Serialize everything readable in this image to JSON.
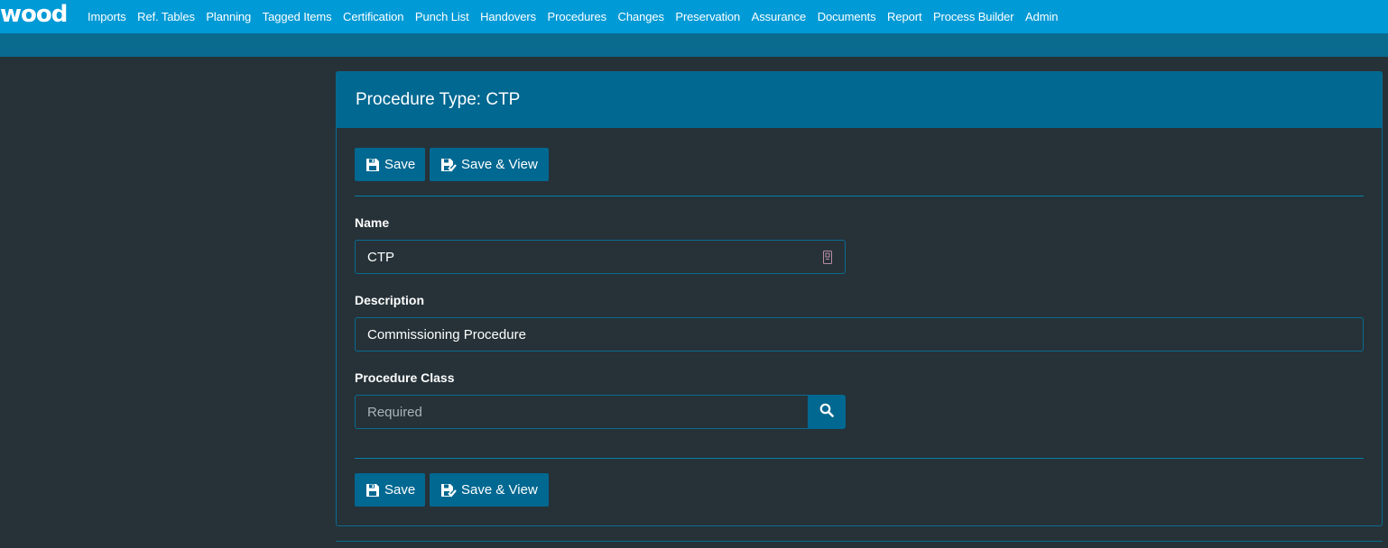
{
  "app": {
    "logo": "wood"
  },
  "nav": {
    "items": [
      "Imports",
      "Ref. Tables",
      "Planning",
      "Tagged Items",
      "Certification",
      "Punch List",
      "Handovers",
      "Procedures",
      "Changes",
      "Preservation",
      "Assurance",
      "Documents",
      "Report",
      "Process Builder",
      "Admin"
    ]
  },
  "panel": {
    "title": "Procedure Type: CTP"
  },
  "toolbar": {
    "save_label": "Save",
    "save_view_label": "Save & View"
  },
  "form": {
    "name_label": "Name",
    "name_value": "CTP",
    "description_label": "Description",
    "description_value": "Commissioning Procedure",
    "class_label": "Procedure Class",
    "class_placeholder": "Required"
  },
  "colors": {
    "topbar": "#009ad6",
    "subbar": "#0a6b8f",
    "background": "#263238",
    "accent": "#006891"
  }
}
